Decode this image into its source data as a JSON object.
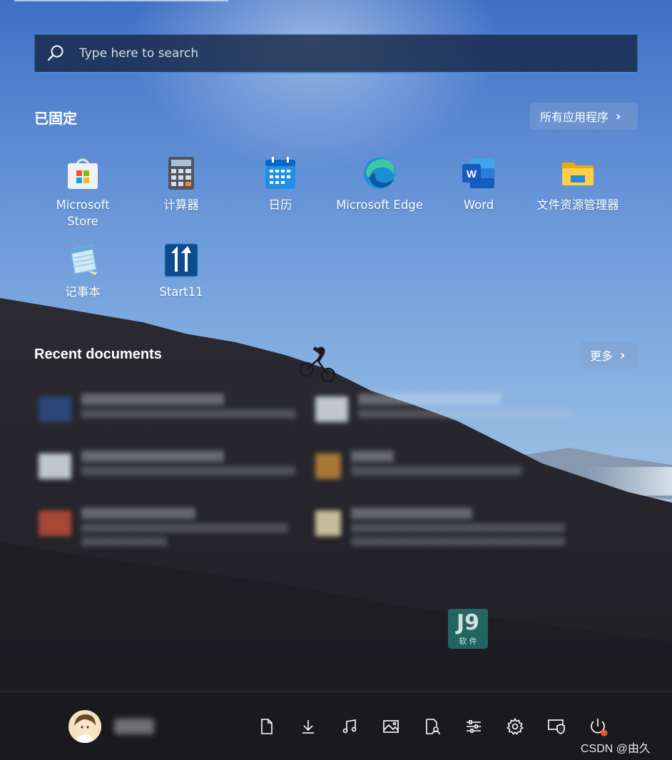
{
  "search": {
    "placeholder": "Type here to search"
  },
  "pinned": {
    "title": "已固定",
    "all_apps_label": "所有应用程序",
    "apps": [
      {
        "label": "Microsoft\nStore",
        "icon": "microsoft-store-icon"
      },
      {
        "label": "计算器",
        "icon": "calculator-icon"
      },
      {
        "label": "日历",
        "icon": "calendar-icon"
      },
      {
        "label": "Microsoft Edge",
        "icon": "edge-icon"
      },
      {
        "label": "Word",
        "icon": "word-icon"
      },
      {
        "label": "文件资源管理器",
        "icon": "file-explorer-icon"
      },
      {
        "label": "记事本",
        "icon": "notepad-icon"
      },
      {
        "label": "Start11",
        "icon": "start11-icon"
      }
    ]
  },
  "recent": {
    "title": "Recent documents",
    "more_label": "更多"
  },
  "watermark": "CSDN @由久",
  "logo_text": {
    "main": "J9",
    "sub": "软 件"
  },
  "colors": {
    "accent": "#4a90e2",
    "notification_dot": "#f05a22"
  }
}
